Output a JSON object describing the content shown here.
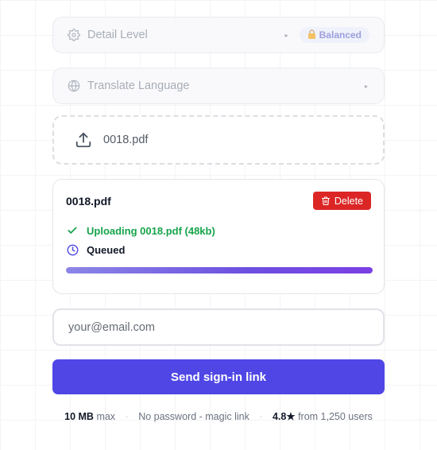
{
  "settings": {
    "detail_level": {
      "label": "Detail Level",
      "badge": "Balanced",
      "icon": "gear-icon",
      "badge_icon": "lock-icon"
    },
    "translate_language": {
      "label": "Translate Language",
      "icon": "globe-icon"
    }
  },
  "upload": {
    "dropzone_filename": "0018.pdf",
    "icon": "upload-icon"
  },
  "file_card": {
    "filename": "0018.pdf",
    "delete_label": "Delete",
    "uploading_text": "Uploading 0018.pdf (48kb)",
    "queued_text": "Queued",
    "progress": 1.0
  },
  "login": {
    "email_placeholder": "your@email.com",
    "send_label": "Send sign-in link"
  },
  "footer": {
    "size_value": "10 MB",
    "size_suffix": "max",
    "password_text": "No password - magic link",
    "rating": "4.8★",
    "rating_suffix": "from 1,250 users"
  },
  "colors": {
    "accent": "#4f46e5",
    "danger": "#dc2626",
    "success": "#16a34a",
    "badge_bg": "#eef0fb",
    "badge_text": "#8b8fd8"
  }
}
